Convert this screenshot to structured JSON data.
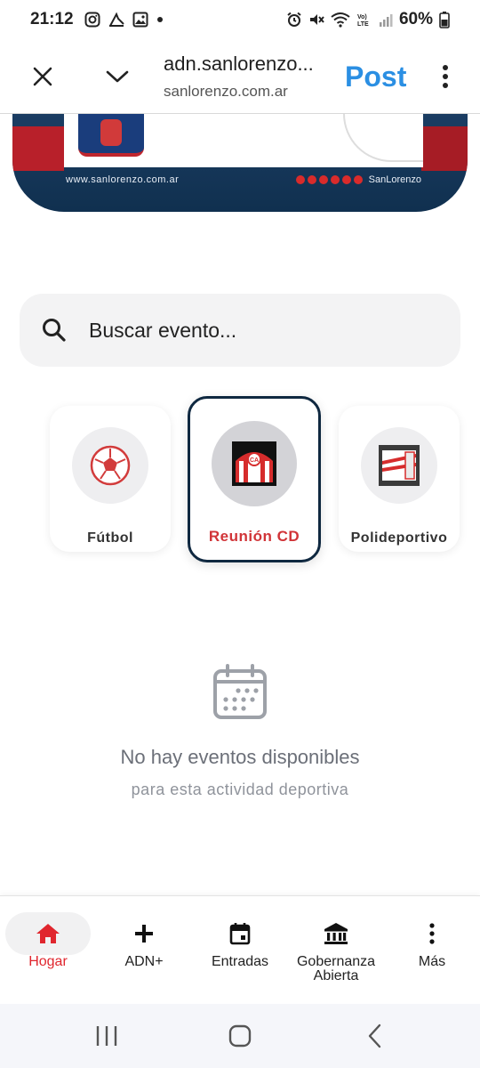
{
  "status_bar": {
    "time": "21:12",
    "battery": "60%",
    "left_icons": [
      "instagram-icon",
      "app-icon",
      "gallery-icon",
      "dot-icon"
    ],
    "right_icons": [
      "alarm-icon",
      "mute-icon",
      "wifi-icon",
      "volte-icon",
      "signal-icon",
      "battery-icon"
    ]
  },
  "browser": {
    "title": "adn.sanlorenzo...",
    "subtitle": "sanlorenzo.com.ar",
    "post_label": "Post"
  },
  "banner": {
    "website": "www.sanlorenzo.com.ar",
    "brand": "SanLorenzo"
  },
  "search": {
    "placeholder": "Buscar evento..."
  },
  "categories": [
    {
      "label": "Fútbol",
      "selected": false
    },
    {
      "label": "Reunión CD",
      "selected": true
    },
    {
      "label": "Polideportivo",
      "selected": false
    }
  ],
  "empty_state": {
    "title": "No hay eventos disponibles",
    "subtitle": "para esta actividad deportiva"
  },
  "bottom_nav": {
    "items": [
      {
        "label": "Hogar",
        "icon": "home-icon",
        "active": true
      },
      {
        "label": "ADN+",
        "icon": "plus-icon",
        "active": false
      },
      {
        "label": "Entradas",
        "icon": "calendar-icon",
        "active": false
      },
      {
        "label": "Gobernanza Abierta",
        "icon": "bank-icon",
        "active": false
      },
      {
        "label": "Más",
        "icon": "more-vert-icon",
        "active": false
      }
    ]
  },
  "colors": {
    "accent_red": "#e0262e",
    "post_blue": "#2b8fe3",
    "selected_border": "#0f2840"
  }
}
